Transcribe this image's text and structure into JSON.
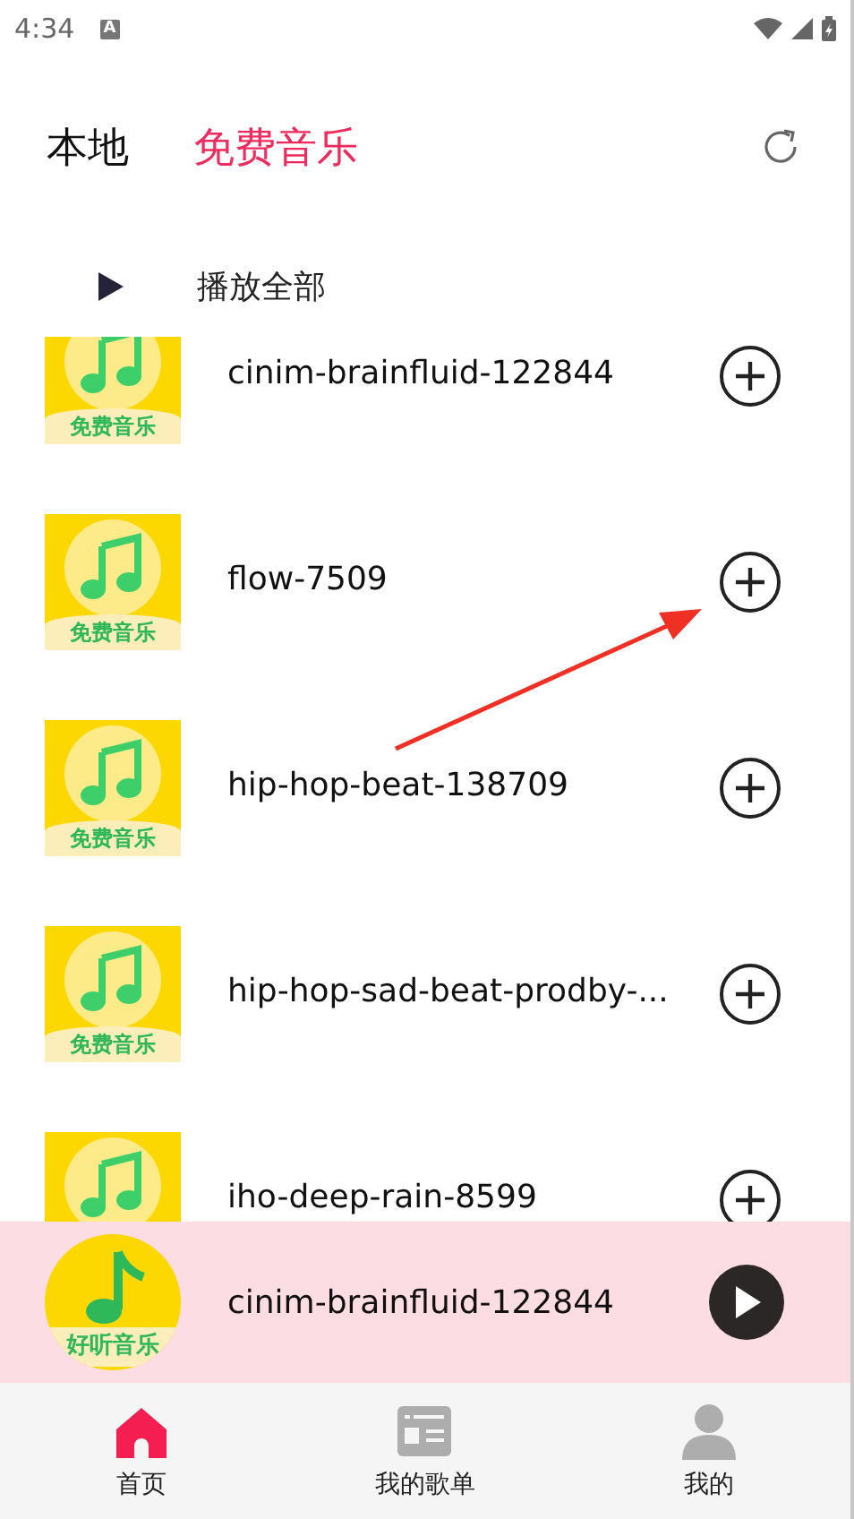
{
  "status_bar": {
    "time": "4:34",
    "notification": "A"
  },
  "tabs": [
    {
      "label": "本地",
      "selected": false
    },
    {
      "label": "免费音乐",
      "selected": true
    }
  ],
  "play_all": {
    "label": "播放全部"
  },
  "songs": [
    {
      "title": "cinim-brainfluid-122844",
      "cover_label": "免费音乐"
    },
    {
      "title": "flow-7509",
      "cover_label": "免费音乐"
    },
    {
      "title": "hip-hop-beat-138709",
      "cover_label": "免费音乐"
    },
    {
      "title": "hip-hop-sad-beat-prodby-...",
      "cover_label": "免费音乐"
    },
    {
      "title": "iho-deep-rain-8599"
    }
  ],
  "player": {
    "title": "cinim-brainfluid-122844",
    "cover_label": "好听音乐"
  },
  "nav": [
    {
      "label": "首页",
      "kind": "home",
      "selected": true
    },
    {
      "label": "我的歌单",
      "kind": "playlist",
      "selected": false
    },
    {
      "label": "我的",
      "kind": "profile",
      "selected": false
    }
  ]
}
